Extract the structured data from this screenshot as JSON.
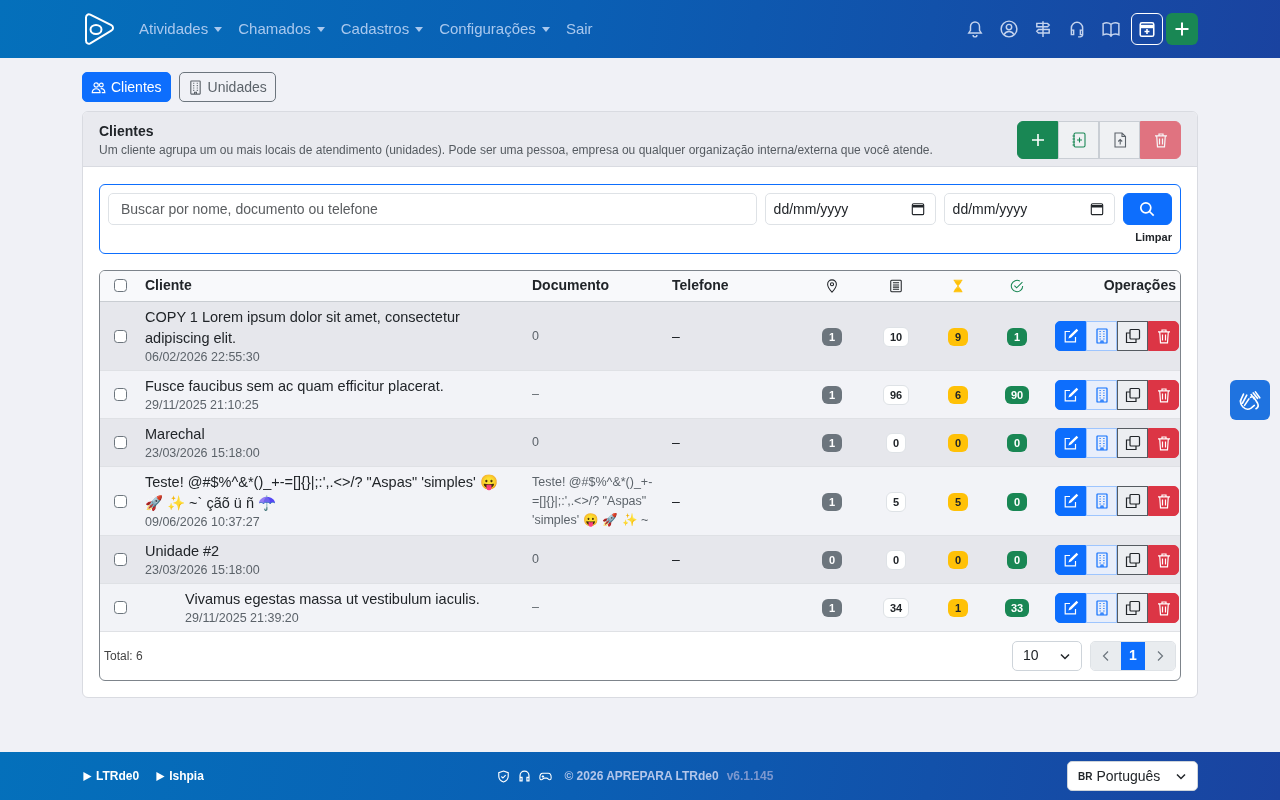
{
  "navbar": {
    "menu": [
      {
        "label": "Atividades",
        "dropdown": true
      },
      {
        "label": "Chamados",
        "dropdown": true
      },
      {
        "label": "Cadastros",
        "dropdown": true
      },
      {
        "label": "Configurações",
        "dropdown": true
      },
      {
        "label": "Sair",
        "dropdown": false
      }
    ]
  },
  "tabs": [
    {
      "label": "Clientes",
      "selected": true
    },
    {
      "label": "Unidades",
      "selected": false
    }
  ],
  "panel": {
    "title": "Clientes",
    "description": "Um cliente agrupa um ou mais locais de atendimento (unidades). Pode ser uma pessoa, empresa ou qualquer organização interna/externa que você atende.",
    "delete_disabled": true
  },
  "filters": {
    "search_placeholder": "Buscar por nome, documento ou telefone",
    "date_from_placeholder": "dd/mm/yyyy",
    "date_to_placeholder": "dd/mm/yyyy",
    "clear": "Limpar"
  },
  "table": {
    "columns": [
      "Cliente",
      "Documento",
      "Telefone",
      "Operações"
    ],
    "select_all_checked": false,
    "rows": [
      {
        "name": "COPY 1 Lorem ipsum dolor sit amet, consectetur adipiscing elit.",
        "created": "06/02/2026 22:55:30",
        "document": "0",
        "phone": "–",
        "counts": [
          "1",
          "10",
          "9",
          "1"
        ],
        "checked": false
      },
      {
        "name": "Fusce faucibus sem ac quam efficitur placerat.",
        "created": "29/11/2025 21:10:25",
        "document": "–",
        "counts": [
          "1",
          "96",
          "6",
          "90"
        ],
        "checked": false
      },
      {
        "name": "Marechal",
        "created": "23/03/2026 15:18:00",
        "document": "0",
        "phone": "–",
        "counts": [
          "1",
          "0",
          "0",
          "0"
        ],
        "checked": false
      },
      {
        "name": "Teste! @#$%^&*()_+-=[]{}|;:',.<>/? \"Aspas\" 'simples' 😛 🚀 ✨ ~` çãõ ü ñ ☂️",
        "created": "09/06/2026 10:37:27",
        "document": "Teste! @#$%^&*()_+-=[]{}|;:',.<>/? \"Aspas\" 'simples' 😛 🚀 ✨ ~",
        "phone": "–",
        "counts": [
          "1",
          "5",
          "5",
          "0"
        ],
        "checked": false
      },
      {
        "name": "Unidade #2",
        "created": "23/03/2026 15:18:00",
        "document": "0",
        "phone": "–",
        "counts": [
          "0",
          "0",
          "0",
          "0"
        ],
        "checked": false,
        "children": [
          {
            "name": "Vivamus egestas massa ut vestibulum iaculis.",
            "created": "29/11/2025 21:39:20",
            "document": "–",
            "counts": [
              "1",
              "34",
              "1",
              "33"
            ],
            "checked": false
          }
        ]
      }
    ]
  },
  "pagination": {
    "total": "Total: 6",
    "page_size": "10",
    "pages": [
      {
        "label": "1",
        "selected": true
      }
    ],
    "previous_disabled": true,
    "next_disabled": true
  },
  "footer": {
    "links": [
      "LTRde0",
      "Ishpia"
    ],
    "copyright": "© 2026 APREPARA LTRde0",
    "version": "v6.1.145",
    "language": {
      "flag": "BR",
      "label": "Português"
    }
  }
}
